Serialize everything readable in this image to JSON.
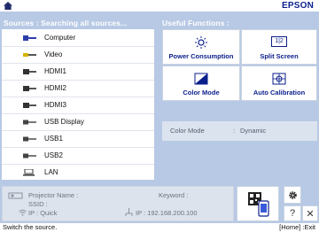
{
  "topbar": {
    "brand": "EPSON"
  },
  "sources": {
    "header": "Sources : Searching all sources...",
    "items": [
      {
        "label": "Computer",
        "icon": "computer-port-icon"
      },
      {
        "label": "Video",
        "icon": "video-cable-icon"
      },
      {
        "label": "HDMI1",
        "icon": "hdmi-cable-icon"
      },
      {
        "label": "HDMI2",
        "icon": "hdmi-cable-icon"
      },
      {
        "label": "HDMI3",
        "icon": "hdmi-cable-icon"
      },
      {
        "label": "USB Display",
        "icon": "usb-cable-icon"
      },
      {
        "label": "USB1",
        "icon": "usb-cable-icon"
      },
      {
        "label": "USB2",
        "icon": "usb-cable-icon"
      },
      {
        "label": "LAN",
        "icon": "lan-icon"
      }
    ]
  },
  "functions": {
    "header": "Useful Functions :",
    "buttons": [
      {
        "label": "Power Consumption",
        "icon": "sun-brightness-icon"
      },
      {
        "label": "Split Screen",
        "icon": "split-screen-icon",
        "icon_text": "1|2"
      },
      {
        "label": "Color Mode",
        "icon": "color-mode-icon"
      },
      {
        "label": "Auto Calibration",
        "icon": "calibration-icon"
      }
    ]
  },
  "color_mode": {
    "label": "Color Mode",
    "separator": ":",
    "value": "Dynamic"
  },
  "info": {
    "projector_name_label": "Projector Name :",
    "ssid_label": "SSID :",
    "ip_mode_label": "IP : Quick",
    "keyword_label": "Keyword :",
    "ip_label": "IP : 192.168.200.100"
  },
  "controls": {
    "help": "?",
    "close": "✕"
  },
  "status": {
    "text": "Switch the source.",
    "keys": "[Home] :Exit"
  },
  "colors": {
    "background": "#b7c9e4",
    "accent": "#0b1f8c",
    "panel": "#ffffff"
  }
}
